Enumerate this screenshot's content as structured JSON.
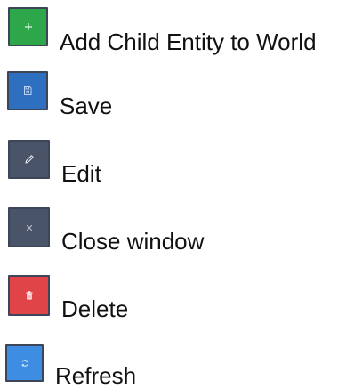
{
  "buttons": [
    {
      "label": "Add Child Entity to World",
      "icon": "plus-icon",
      "color": "#2ea74a"
    },
    {
      "label": "Save",
      "icon": "save-icon",
      "color": "#2f6fc0"
    },
    {
      "label": "Edit",
      "icon": "pencil-icon",
      "color": "#4a5468"
    },
    {
      "label": "Close window",
      "icon": "close-icon",
      "color": "#4a5468"
    },
    {
      "label": "Delete",
      "icon": "trash-icon",
      "color": "#e04448"
    },
    {
      "label": "Refresh",
      "icon": "refresh-icon",
      "color": "#3d8de3"
    }
  ]
}
